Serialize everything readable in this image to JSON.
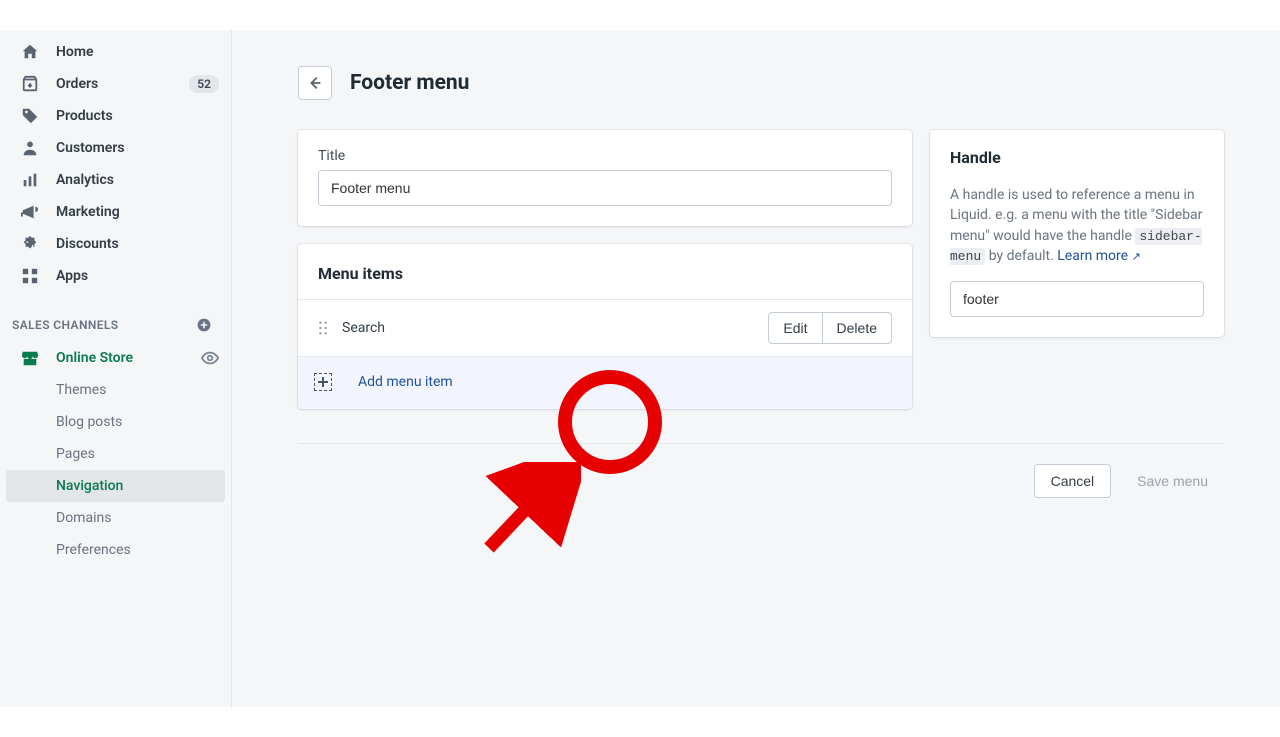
{
  "sidebar": {
    "primary": [
      {
        "label": "Home"
      },
      {
        "label": "Orders",
        "badge": "52"
      },
      {
        "label": "Products"
      },
      {
        "label": "Customers"
      },
      {
        "label": "Analytics"
      },
      {
        "label": "Marketing"
      },
      {
        "label": "Discounts"
      },
      {
        "label": "Apps"
      }
    ],
    "channels_heading": "SALES CHANNELS",
    "online_store": "Online Store",
    "sub": [
      {
        "label": "Themes"
      },
      {
        "label": "Blog posts"
      },
      {
        "label": "Pages"
      },
      {
        "label": "Navigation",
        "active": true
      },
      {
        "label": "Domains"
      },
      {
        "label": "Preferences"
      }
    ]
  },
  "page": {
    "title": "Footer menu",
    "title_card": {
      "field_label": "Title",
      "value": "Footer menu"
    },
    "menu_items": {
      "heading": "Menu items",
      "rows": [
        {
          "name": "Search",
          "edit": "Edit",
          "delete": "Delete"
        }
      ],
      "add_label": "Add menu item"
    },
    "handle": {
      "heading": "Handle",
      "desc_pre": "A handle is used to reference a menu in Liquid. e.g. a menu with the title \"Sidebar menu\" would have the handle ",
      "code": "sidebar-menu",
      "desc_mid": " by default. ",
      "link": "Learn more",
      "value": "footer"
    },
    "footer": {
      "cancel": "Cancel",
      "save": "Save menu"
    }
  }
}
